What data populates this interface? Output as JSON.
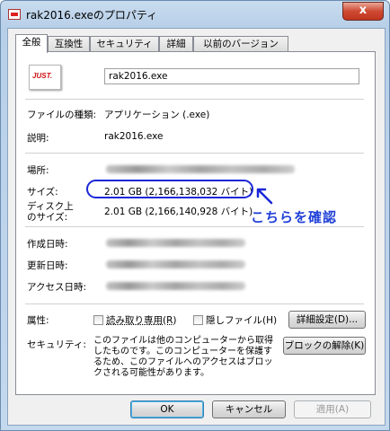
{
  "window": {
    "title": "rak2016.exeのプロパティ",
    "close": "x"
  },
  "tabs": [
    "全般",
    "互換性",
    "セキュリティ",
    "詳細",
    "以前のバージョン"
  ],
  "app_icon_text": "JUST.",
  "file_name": "rak2016.exe",
  "rows": {
    "type_label": "ファイルの種類:",
    "type_value": "アプリケーション (.exe)",
    "desc_label": "説明:",
    "desc_value": "rak2016.exe",
    "location_label": "場所:",
    "size_label": "サイズ:",
    "size_value": "2.01 GB (2,166,138,032 バイト)",
    "disk_label_1": "ディスク上",
    "disk_label_2": "のサイズ:",
    "disk_value": "2.01 GB (2,166,140,928 バイト)",
    "created_label": "作成日時:",
    "modified_label": "更新日時:",
    "accessed_label": "アクセス日時:"
  },
  "attributes": {
    "label": "属性:",
    "readonly": "読み取り専用(R)",
    "hidden": "隠しファイル(H)",
    "advanced_button": "詳細設定(D)..."
  },
  "security": {
    "label": "セキュリティ:",
    "text": "このファイルは他のコンピューターから取得したものです。このコンピューターを保護するため、このファイルへのアクセスはブロックされる可能性があります。",
    "unblock_button": "ブロックの解除(K)"
  },
  "annotation": "こちらを確認",
  "buttons": {
    "ok": "OK",
    "cancel": "キャンセル",
    "apply": "適用(A)"
  }
}
